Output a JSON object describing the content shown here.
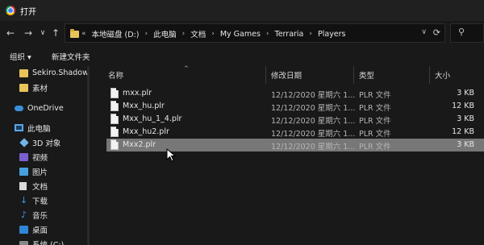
{
  "window": {
    "title": "打开"
  },
  "nav": {
    "back": "←",
    "forward": "→",
    "recent": "∨",
    "up": "↑"
  },
  "address": {
    "crumbs": [
      "本地磁盘 (D:)",
      "此电脑",
      "文档",
      "My Games",
      "Terraria",
      "Players"
    ],
    "separator": "›",
    "overflow": "«",
    "dropdown": "∨",
    "refresh": "⟳"
  },
  "search": {
    "icon": "⚲"
  },
  "commands": {
    "organize": "组织 ▾",
    "new_folder": "新建文件夹"
  },
  "sidebar": {
    "items": [
      {
        "label": "Sekiro.Shadow",
        "icon": "folder-icon"
      },
      {
        "label": "素材",
        "icon": "folder-icon"
      },
      {
        "label": "OneDrive",
        "icon": "cloud-icon"
      },
      {
        "label": "此电脑",
        "icon": "computer-icon"
      },
      {
        "label": "3D 对象",
        "icon": "cube-icon"
      },
      {
        "label": "视频",
        "icon": "video-icon"
      },
      {
        "label": "图片",
        "icon": "picture-icon"
      },
      {
        "label": "文档",
        "icon": "document-icon"
      },
      {
        "label": "下载",
        "icon": "download-icon"
      },
      {
        "label": "音乐",
        "icon": "music-icon"
      },
      {
        "label": "桌面",
        "icon": "desktop-icon"
      },
      {
        "label": "系统 (C:)",
        "icon": "drive-icon"
      }
    ]
  },
  "table": {
    "columns": [
      "名称",
      "修改日期",
      "类型",
      "大小"
    ],
    "rows": [
      {
        "name": "mxx.plr",
        "date": "12/12/2020 星期六 1...",
        "type": "PLR 文件",
        "size": "3 KB"
      },
      {
        "name": "Mxx_hu.plr",
        "date": "12/12/2020 星期六 1...",
        "type": "PLR 文件",
        "size": "12 KB"
      },
      {
        "name": "Mxx_hu_1_4.plr",
        "date": "12/12/2020 星期六 1...",
        "type": "PLR 文件",
        "size": "3 KB"
      },
      {
        "name": "Mxx_hu2.plr",
        "date": "12/12/2020 星期六 1...",
        "type": "PLR 文件",
        "size": "12 KB"
      },
      {
        "name": "Mxx2.plr",
        "date": "12/12/2020 星期六 1...",
        "type": "PLR 文件",
        "size": "3 KB",
        "selected": true
      }
    ]
  },
  "colors": {
    "background": "#191919",
    "selection": "#777777",
    "folder": "#e8c35a",
    "accent": "#3f9cf0"
  }
}
